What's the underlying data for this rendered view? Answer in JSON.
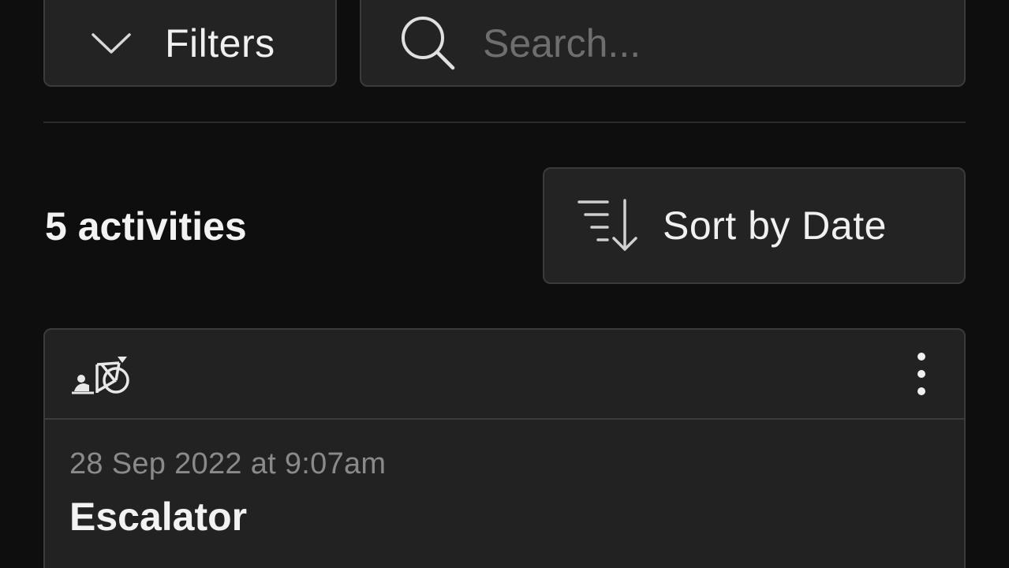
{
  "toolbar": {
    "filters_label": "Filters",
    "search_placeholder": "Search...",
    "search_value": ""
  },
  "summary": {
    "activity_count": "5 activities",
    "sort_label": "Sort by Date"
  },
  "activities": [
    {
      "type_icon": "bike-trainer-icon",
      "date": "28 Sep 2022 at 9:07am",
      "title": "Escalator"
    }
  ],
  "colors": {
    "background": "#0e0e0e",
    "surface": "#232323",
    "border": "#3b3b3b",
    "text_primary": "#f0f0f0",
    "text_muted": "#8a8a8a"
  }
}
